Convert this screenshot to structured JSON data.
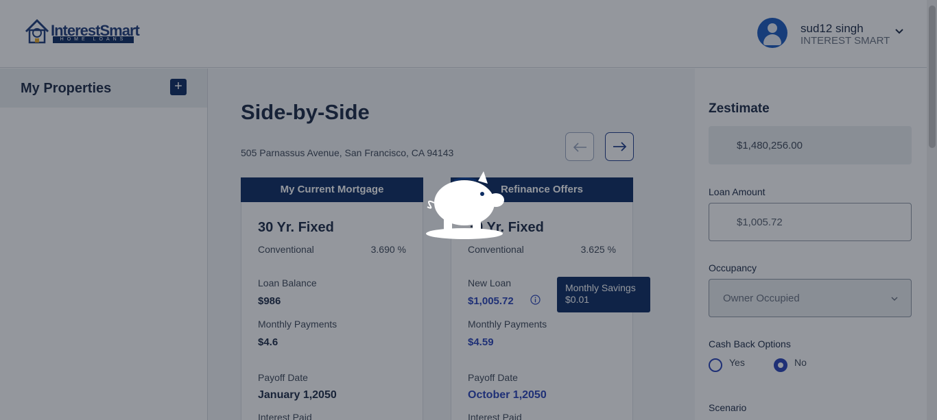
{
  "header": {
    "logo": {
      "brand_part1": "Interest",
      "brand_part2": "Smart",
      "subtitle": "HOME LOANS"
    },
    "user": {
      "name": "sud12 singh",
      "company": "INTEREST SMART"
    }
  },
  "sidebar": {
    "title": "My Properties",
    "add_label": "+"
  },
  "main": {
    "title": "Side-by-Side",
    "address": "505 Parnassus Avenue, San Francisco, CA 94143",
    "cards": [
      {
        "header": "My Current Mortgage",
        "title": "30 Yr. Fixed",
        "type": "Conventional",
        "rate": "3.690 %",
        "loan_label": "Loan Balance",
        "loan_value": "$986",
        "monthly_label": "Monthly Payments",
        "monthly_value": "$4.6",
        "payoff_label": "Payoff Date",
        "payoff_value": "January 1,2050",
        "interest_label": "Interest Paid"
      },
      {
        "header": "Refinance Offers",
        "title": "30 Yr. Fixed",
        "type": "Conventional",
        "rate": "3.625 %",
        "loan_label": "New Loan",
        "loan_value": "$1,005.72",
        "monthly_label": "Monthly Payments",
        "monthly_value": "$4.59",
        "payoff_label": "Payoff Date",
        "payoff_value": "October 1,2050",
        "interest_label": "Interest Paid"
      }
    ],
    "tooltip": {
      "line1": "Monthly Savings",
      "line2": "$0.01"
    }
  },
  "right_panel": {
    "zestimate_title": "Zestimate",
    "zestimate_value": "$1,480,256.00",
    "loan_amount_label": "Loan Amount",
    "loan_amount_value": "$1,005.72",
    "occupancy_label": "Occupancy",
    "occupancy_value": "Owner Occupied",
    "cash_back_label": "Cash Back Options",
    "cash_back_yes": "Yes",
    "cash_back_no": "No",
    "cash_back_selected": "No",
    "scenario_label": "Scenario"
  },
  "colors": {
    "brand_navy": "#0d2d63",
    "accent_blue": "#2a44b8",
    "overlay": "rgba(18,24,38,0.45)"
  }
}
